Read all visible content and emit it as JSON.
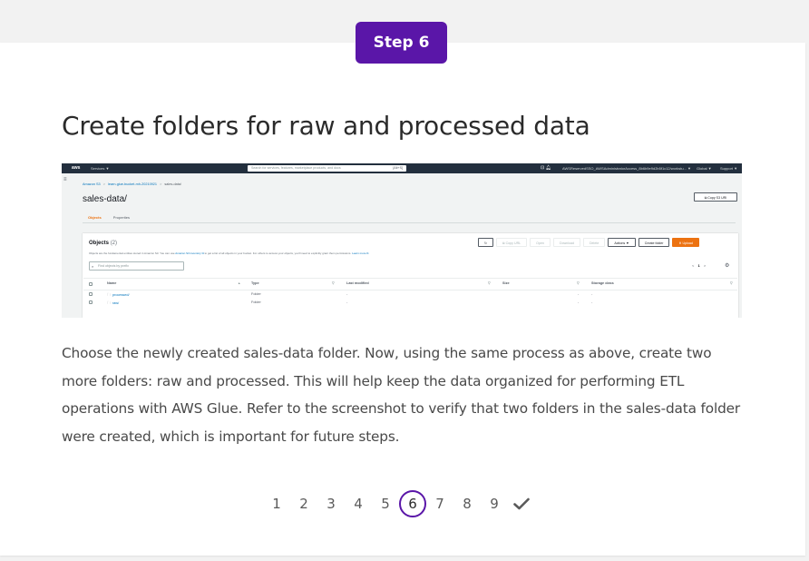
{
  "step": {
    "label": "Step 6"
  },
  "title": "Create folders for raw and processed data",
  "screenshot": {
    "nav": {
      "logo": "aws",
      "services": "Services ▼",
      "search_placeholder": "Search for services, features, marketplace products, and docs",
      "search_shortcut": "[Alt+S]",
      "icons": [
        "terminal-icon",
        "bell-icon"
      ],
      "account": "AWSReservedSSO_AWSAdministratorAccess_8b6b9e9d2b5f1c12/workstu... ▼",
      "region": "Global ▼",
      "support": "Support ▼"
    },
    "breadcrumb": {
      "root": "Amazon S3",
      "sep1": ">",
      "bucket": "learn-glue-bucket-mh-20210921",
      "sep2": ">",
      "current": "sales-data/"
    },
    "folder_title": "sales-data/",
    "copy_uri": "⧉ Copy S3 URI",
    "tabs": [
      "Objects",
      "Properties"
    ],
    "objects": {
      "title": "Objects",
      "count": "(2)",
      "desc_pre": "Objects are the fundamental entities stored in Amazon S3. You can use ",
      "desc_link": "Amazon S3 inventory ⧉",
      "desc_post": " to get a list of all objects in your bucket. For others to access your objects, you'll need to explicitly grant them permissions. ",
      "desc_learn": "Learn more ⧉",
      "toolbar": {
        "refresh": "↻",
        "copy_url": "⧉ Copy URL",
        "open": "Open",
        "download": "Download",
        "delete": "Delete",
        "actions": "Actions ▼",
        "create_folder": "Create folder",
        "upload": "⬆ Upload"
      },
      "filter_placeholder": "Find objects by prefix",
      "pager": {
        "prev": "<",
        "current": "1",
        "next": ">"
      },
      "columns": {
        "name": "Name",
        "type": "Type",
        "last_modified": "Last modified",
        "size": "Size",
        "storage_class": "Storage class"
      },
      "sort_asc": "▲",
      "sort_desc": "▽",
      "rows": [
        {
          "name": "processed/",
          "type": "Folder",
          "last_modified": "-",
          "size": "-",
          "storage_class": "-"
        },
        {
          "name": "raw/",
          "type": "Folder",
          "last_modified": "-",
          "size": "-",
          "storage_class": "-"
        }
      ]
    }
  },
  "description": "Choose the newly created sales-data folder. Now, using the same process as above, create two more folders: raw and processed. This will help keep the data organized for performing ETL operations with AWS Glue. Refer to the screenshot to verify that two folders in the sales-data folder were created, which is important for future steps.",
  "pagination": {
    "pages": [
      "1",
      "2",
      "3",
      "4",
      "5",
      "6",
      "7",
      "8",
      "9"
    ],
    "current": "6",
    "done_icon": "check-icon"
  },
  "colors": {
    "accent": "#5a16a8",
    "aws_nav": "#232f3e",
    "aws_orange": "#ec7211",
    "aws_link": "#0073bb"
  }
}
